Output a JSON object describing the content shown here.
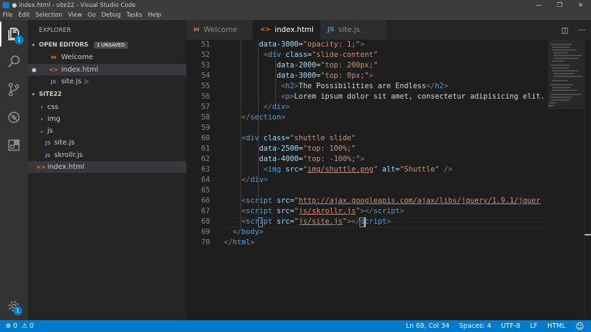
{
  "window": {
    "title": "● index.html - site22 - Visual Studio Code",
    "controls": [
      "—",
      "❐",
      "✕"
    ]
  },
  "menu": [
    "File",
    "Edit",
    "Selection",
    "View",
    "Go",
    "Debug",
    "Tasks",
    "Help"
  ],
  "activity": {
    "explorer_badge": "1",
    "settings_badge": "1"
  },
  "explorer": {
    "title": "EXPLORER",
    "open_editors": {
      "label": "OPEN EDITORS",
      "badge": "1 UNSAVED",
      "items": [
        {
          "name": "Welcome",
          "icon": "vscode-icon"
        },
        {
          "name": "index.html",
          "icon": "html-icon",
          "modified": true
        },
        {
          "name": "site.js",
          "icon": "js-icon",
          "dir": "js"
        }
      ]
    },
    "folder": {
      "label": "SITE22",
      "items": [
        {
          "name": "css",
          "type": "folder"
        },
        {
          "name": "img",
          "type": "folder"
        },
        {
          "name": "js",
          "type": "folder-open"
        },
        {
          "name": "site.js",
          "type": "js"
        },
        {
          "name": "skrollr.js",
          "type": "js"
        },
        {
          "name": "index.html",
          "type": "html"
        }
      ]
    }
  },
  "tabs": [
    {
      "label": "Welcome",
      "icon_text": "⋈"
    },
    {
      "label": "index.html",
      "icon_text": "<>"
    },
    {
      "label": "site.js",
      "icon_text": "JS"
    }
  ],
  "editor": {
    "line_numbers": [
      "51",
      "52",
      "53",
      "54",
      "55",
      "56",
      "57",
      "58",
      "59",
      "60",
      "61",
      "62",
      "63",
      "64",
      "65",
      "66",
      "67",
      "68",
      "69",
      "70"
    ]
  },
  "statusbar": {
    "errors": "0",
    "warnings": "0",
    "position": "Ln 68, Col 34",
    "spaces": "Spaces: 4",
    "encoding": "UTF-8",
    "eol": "LF",
    "language": "HTML",
    "smiley": "☺"
  },
  "colors": {
    "accent": "#007acc",
    "tag": "#569cd6",
    "attribute": "#9cdcfe",
    "string": "#ce9178"
  }
}
